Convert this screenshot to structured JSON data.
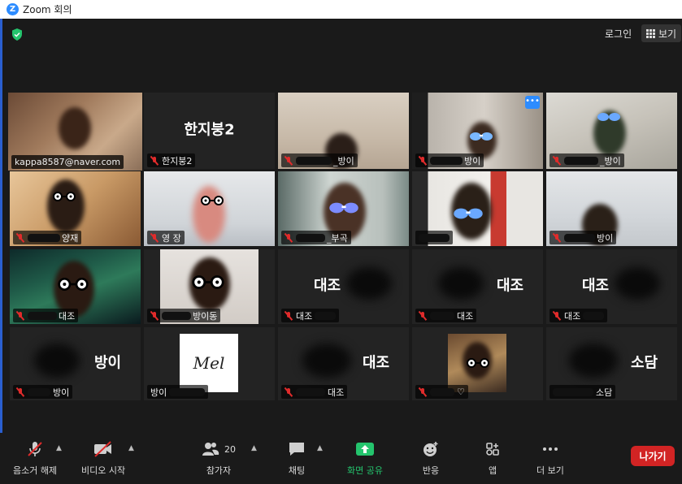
{
  "window": {
    "title": "Zoom 회의"
  },
  "top": {
    "login": "로그인",
    "view": "보기"
  },
  "tiles": [
    {
      "label": "kappa8587@naver.com"
    },
    {
      "name": "한지붕2",
      "label": "한지붕2"
    },
    {
      "label": "_방이"
    },
    {
      "label": "방이"
    },
    {
      "label": "_방이"
    },
    {
      "label": "양재"
    },
    {
      "label": "영 장"
    },
    {
      "label": "_부곡"
    },
    {
      "label": ""
    },
    {
      "label": "방이"
    },
    {
      "label": "대조"
    },
    {
      "label": "방이동"
    },
    {
      "name": "대조",
      "label": "대조"
    },
    {
      "name": "대조",
      "label": "대조"
    },
    {
      "name": "대조",
      "label": "대조"
    },
    {
      "name": "방이",
      "label": "방이"
    },
    {
      "label": "방이",
      "mel": "Mel"
    },
    {
      "name": "대조",
      "label": "대조"
    },
    {
      "label": "♡"
    },
    {
      "name": "소담",
      "label": "소담"
    }
  ],
  "toolbar": {
    "mute": "음소거 해제",
    "video": "비디오 시작",
    "participants": "참가자",
    "participants_count": "20",
    "chat": "채팅",
    "share": "화면 공유",
    "reactions": "반응",
    "apps": "앱",
    "more": "더 보기",
    "leave": "나가기"
  },
  "colors": {
    "share_green": "#24c46d",
    "leave_red": "#d22424",
    "active_speaker": "#c8e06a",
    "zoom_blue": "#2d8cff"
  }
}
